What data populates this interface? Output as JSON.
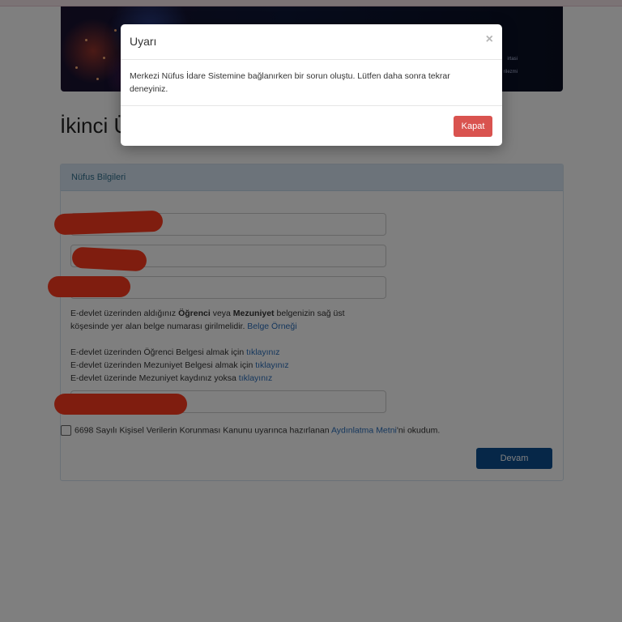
{
  "banner": {
    "note_line1": "irtasi",
    "note_line2": "rilezmi"
  },
  "page": {
    "title": "İkinci Üniversite Başvurusu"
  },
  "panel": {
    "header": "Nüfus Bilgileri",
    "info_pre": "E-devlet üzerinden aldığınız ",
    "info_bold1": "Öğrenci",
    "info_mid": " veya ",
    "info_bold2": "Mezuniyet",
    "info_post": " belgenizin sağ üst köşesinde yer alan belge numarası girilmelidir. ",
    "info_link": "Belge Örneği",
    "line1_text": "E-devlet üzerinden Öğrenci Belgesi almak için ",
    "line1_link": "tıklayınız",
    "line2_text": "E-devlet üzerinden Mezuniyet Belgesi almak için ",
    "line2_link": "tıklayınız",
    "line3_text": "E-devlet üzerinde Mezuniyet kaydınız yoksa ",
    "line3_link": "tıklayınız",
    "consent_pre": "6698 Sayılı Kişisel Verilerin Korunması Kanunu uyarınca hazırlanan ",
    "consent_link": "Aydınlatma Metni",
    "consent_post": "'ni okudum.",
    "submit_label": "Devam"
  },
  "modal": {
    "title": "Uyarı",
    "close_glyph": "×",
    "message": "Merkezi Nüfus İdare Sistemine bağlanırken bir sorun oluştu. Lütfen daha sonra tekrar deneyiniz.",
    "button_label": "Kapat"
  },
  "colors": {
    "accent": "#0d4e90",
    "danger": "#d9534f",
    "link": "#2a6ebb",
    "panel_header": "#d9e7f5"
  }
}
